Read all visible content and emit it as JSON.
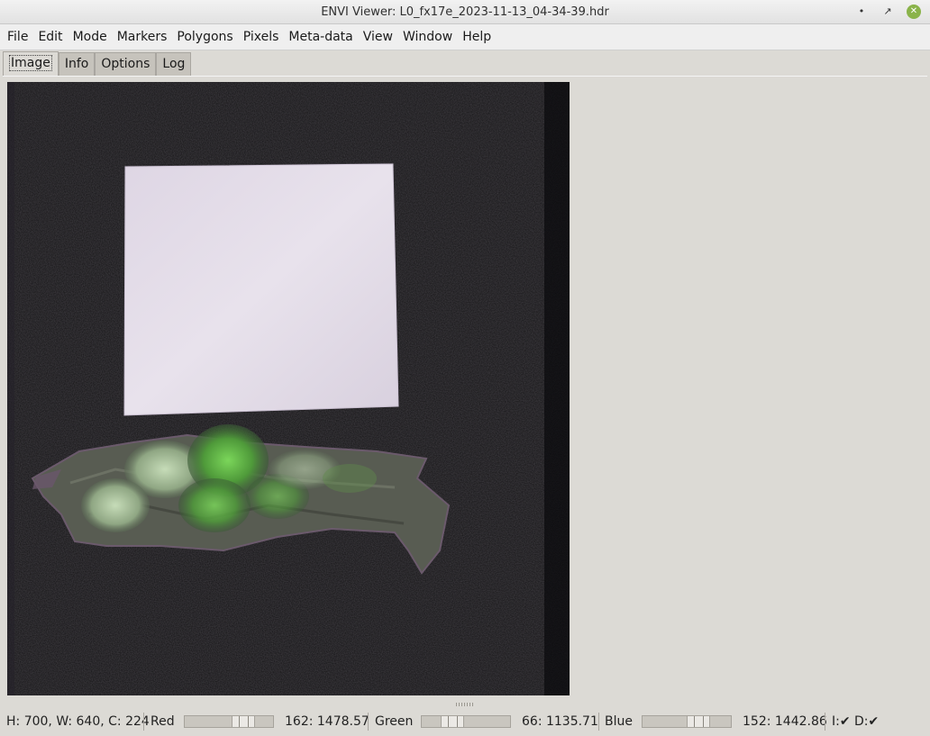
{
  "window": {
    "title": "ENVI Viewer: L0_fx17e_2023-11-13_04-34-39.hdr",
    "minimize_glyph": "•",
    "maximize_glyph": "↗",
    "close_glyph": "✕"
  },
  "menubar": {
    "items": [
      "File",
      "Edit",
      "Mode",
      "Markers",
      "Polygons",
      "Pixels",
      "Meta-data",
      "View",
      "Window",
      "Help"
    ]
  },
  "tabs": [
    "Image",
    "Info",
    "Options",
    "Log"
  ],
  "active_tab": "Image",
  "status": {
    "dims": "H: 700, W: 640, C: 224",
    "red_label": "Red",
    "red_value": "162: 1478.57",
    "red_slider_fraction": 0.72,
    "green_label": "Green",
    "green_value": "66: 1135.71",
    "green_slider_fraction": 0.29,
    "blue_label": "Blue",
    "blue_value": "152: 1442.86",
    "blue_slider_fraction": 0.68,
    "flags": "I:✔ D:✔"
  },
  "colors": {
    "background": "#dcdad5",
    "image_background": "#121113",
    "reference_panel": "#e4dde8",
    "lichen_green": "#5fbf3f",
    "bark": "#5b5f55"
  },
  "icons": {
    "close": "close-icon",
    "minimize": "minimize-icon",
    "maximize": "maximize-icon"
  }
}
